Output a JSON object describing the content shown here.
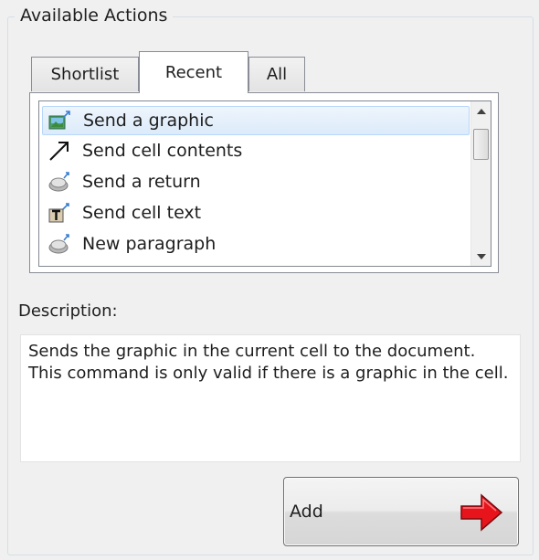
{
  "group": {
    "title": "Available Actions"
  },
  "tabs": [
    {
      "label": "Shortlist",
      "selected": false
    },
    {
      "label": "Recent",
      "selected": true
    },
    {
      "label": "All",
      "selected": false
    }
  ],
  "actions": [
    {
      "label": "Send a graphic",
      "icon": "send-graphic-icon",
      "selected": true
    },
    {
      "label": "Send cell contents",
      "icon": "arrow-up-right-icon",
      "selected": false
    },
    {
      "label": "Send a return",
      "icon": "return-key-icon",
      "selected": false
    },
    {
      "label": "Send cell text",
      "icon": "send-text-icon",
      "selected": false
    },
    {
      "label": "New paragraph",
      "icon": "paragraph-key-icon",
      "selected": false
    }
  ],
  "description": {
    "label": "Description:",
    "text": "Sends the graphic in the current cell to the document. This command is only valid if there is a graphic in the cell."
  },
  "add_button": {
    "label": "Add",
    "icon": "red-arrow-right-icon"
  },
  "colors": {
    "selection_border": "#b8d6fb",
    "selection_fill": "#dcebfa",
    "arrow_red": "#e8141b"
  }
}
